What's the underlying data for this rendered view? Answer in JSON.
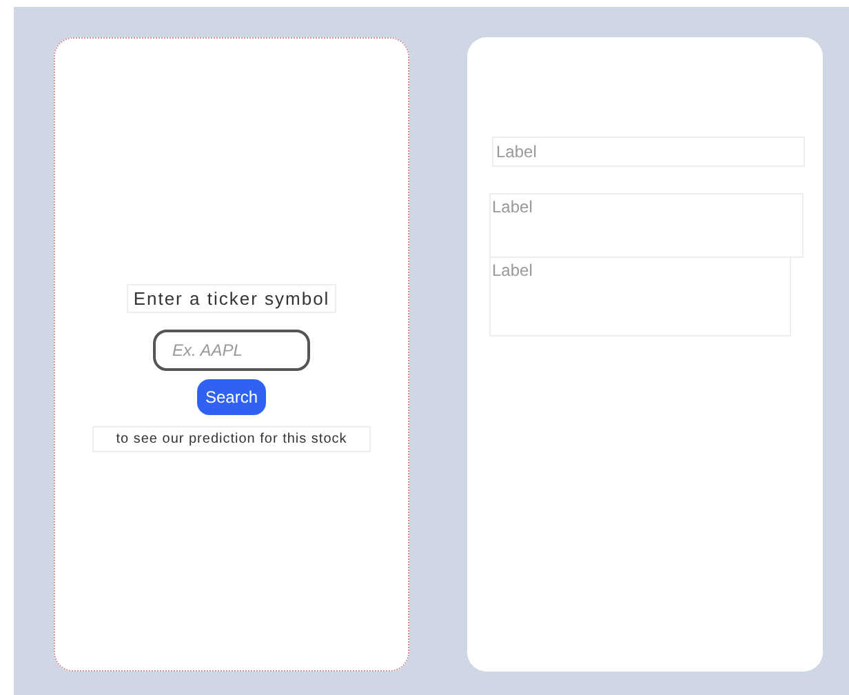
{
  "search_card": {
    "heading": "Enter a ticker symbol",
    "ticker_field": {
      "placeholder": "Ex. AAPL"
    },
    "search_button": "Search",
    "caption": "to see our prediction for this stock"
  },
  "results_card": {
    "fields": [
      {
        "kind": "line",
        "placeholder": "Label"
      },
      {
        "kind": "area",
        "placeholder": "Label"
      },
      {
        "kind": "area",
        "placeholder": "Label"
      }
    ]
  }
}
